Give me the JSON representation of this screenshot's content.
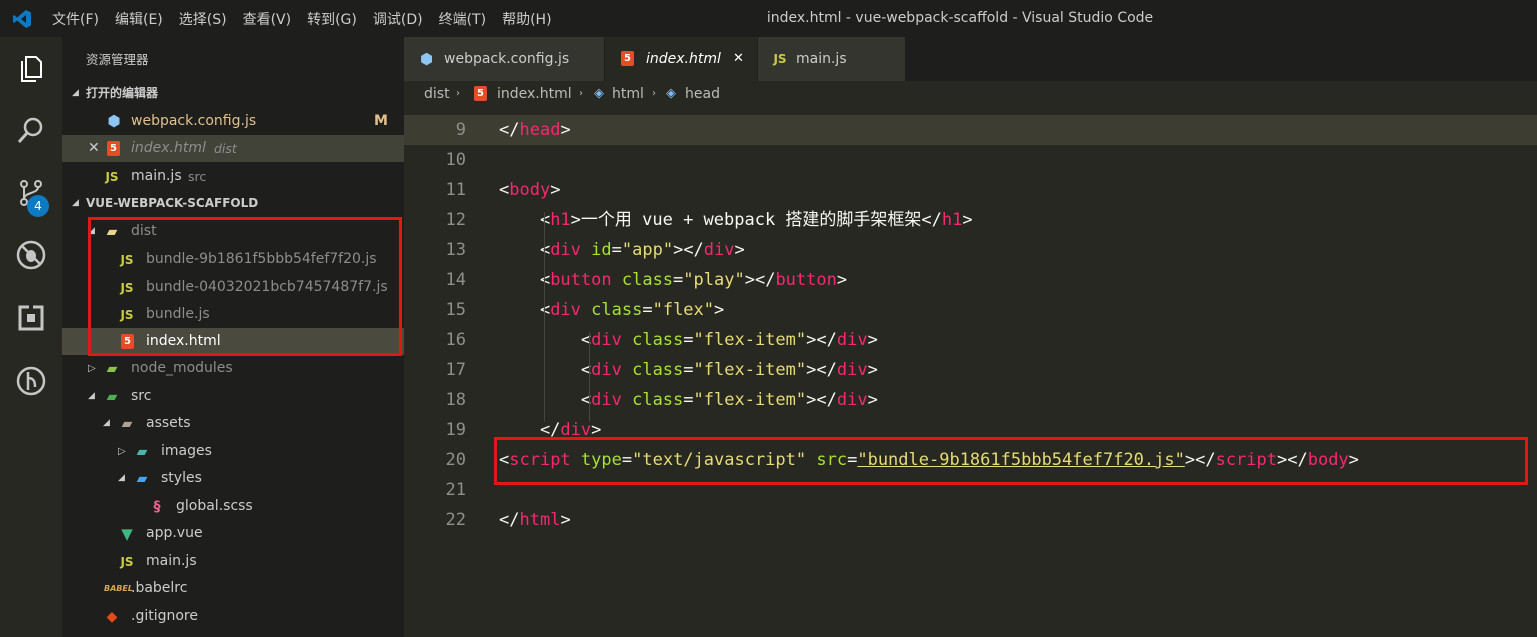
{
  "menu": [
    "文件(F)",
    "编辑(E)",
    "选择(S)",
    "查看(V)",
    "转到(G)",
    "调试(D)",
    "终端(T)",
    "帮助(H)"
  ],
  "window_title": "index.html - vue-webpack-scaffold - Visual Studio Code",
  "activity": {
    "scm_badge": "4"
  },
  "sidebar": {
    "title": "资源管理器",
    "open_editors_header": "打开的编辑器",
    "open_editors": [
      {
        "name": "webpack.config.js",
        "status": "M"
      },
      {
        "name": "index.html",
        "desc": "dist"
      },
      {
        "name": "main.js",
        "desc": "src"
      }
    ],
    "project_header": "VUE-WEBPACK-SCAFFOLD",
    "tree": [
      {
        "name": "dist"
      },
      {
        "name": "bundle-9b1861f5bbb54fef7f20.js"
      },
      {
        "name": "bundle-04032021bcb7457487f7.js"
      },
      {
        "name": "bundle.js"
      },
      {
        "name": "index.html"
      },
      {
        "name": "node_modules"
      },
      {
        "name": "src"
      },
      {
        "name": "assets"
      },
      {
        "name": "images"
      },
      {
        "name": "styles"
      },
      {
        "name": "global.scss"
      },
      {
        "name": "app.vue"
      },
      {
        "name": "main.js"
      },
      {
        "name": ".babelrc"
      },
      {
        "name": ".gitignore"
      }
    ]
  },
  "tabs": [
    {
      "label": "webpack.config.js"
    },
    {
      "label": "index.html",
      "close": "✕"
    },
    {
      "label": "main.js"
    }
  ],
  "breadcrumb": [
    "dist",
    "index.html",
    "html",
    "head"
  ],
  "editor": {
    "line_numbers": [
      "9",
      "10",
      "11",
      "12",
      "13",
      "14",
      "15",
      "16",
      "17",
      "18",
      "19",
      "20",
      "21",
      "22"
    ],
    "lines": [
      [
        [
          "p",
          "</"
        ],
        [
          "t",
          "head"
        ],
        [
          "p",
          ">"
        ]
      ],
      [],
      [
        [
          "p",
          "<"
        ],
        [
          "t",
          "body"
        ],
        [
          "p",
          ">"
        ]
      ],
      [
        [
          "p",
          "    <"
        ],
        [
          "t",
          "h1"
        ],
        [
          "p",
          ">一个用 vue + webpack 搭建的脚手架框架</"
        ],
        [
          "t",
          "h1"
        ],
        [
          "p",
          ">"
        ]
      ],
      [
        [
          "p",
          "    <"
        ],
        [
          "t",
          "div"
        ],
        [
          "p",
          " "
        ],
        [
          "a",
          "id"
        ],
        [
          "p",
          "="
        ],
        [
          "s",
          "\"app\""
        ],
        [
          "p",
          "></"
        ],
        [
          "t",
          "div"
        ],
        [
          "p",
          ">"
        ]
      ],
      [
        [
          "p",
          "    <"
        ],
        [
          "t",
          "button"
        ],
        [
          "p",
          " "
        ],
        [
          "a",
          "class"
        ],
        [
          "p",
          "="
        ],
        [
          "s",
          "\"play\""
        ],
        [
          "p",
          "></"
        ],
        [
          "t",
          "button"
        ],
        [
          "p",
          ">"
        ]
      ],
      [
        [
          "p",
          "    <"
        ],
        [
          "t",
          "div"
        ],
        [
          "p",
          " "
        ],
        [
          "a",
          "class"
        ],
        [
          "p",
          "="
        ],
        [
          "s",
          "\"flex\""
        ],
        [
          "p",
          ">"
        ]
      ],
      [
        [
          "p",
          "        <"
        ],
        [
          "t",
          "div"
        ],
        [
          "p",
          " "
        ],
        [
          "a",
          "class"
        ],
        [
          "p",
          "="
        ],
        [
          "s",
          "\"flex-item\""
        ],
        [
          "p",
          "></"
        ],
        [
          "t",
          "div"
        ],
        [
          "p",
          ">"
        ]
      ],
      [
        [
          "p",
          "        <"
        ],
        [
          "t",
          "div"
        ],
        [
          "p",
          " "
        ],
        [
          "a",
          "class"
        ],
        [
          "p",
          "="
        ],
        [
          "s",
          "\"flex-item\""
        ],
        [
          "p",
          "></"
        ],
        [
          "t",
          "div"
        ],
        [
          "p",
          ">"
        ]
      ],
      [
        [
          "p",
          "        <"
        ],
        [
          "t",
          "div"
        ],
        [
          "p",
          " "
        ],
        [
          "a",
          "class"
        ],
        [
          "p",
          "="
        ],
        [
          "s",
          "\"flex-item\""
        ],
        [
          "p",
          "></"
        ],
        [
          "t",
          "div"
        ],
        [
          "p",
          ">"
        ]
      ],
      [
        [
          "p",
          "    </"
        ],
        [
          "t",
          "div"
        ],
        [
          "p",
          ">"
        ]
      ],
      [
        [
          "p",
          "<"
        ],
        [
          "t",
          "script"
        ],
        [
          "p",
          " "
        ],
        [
          "a",
          "type"
        ],
        [
          "p",
          "="
        ],
        [
          "s",
          "\"text/javascript\""
        ],
        [
          "p",
          " "
        ],
        [
          "a",
          "src"
        ],
        [
          "p",
          "="
        ],
        [
          "s",
          "\"bundle-9b1861f5bbb54fef7f20.js\""
        ],
        [
          "p",
          "></"
        ],
        [
          "t",
          "script"
        ],
        [
          "p",
          "></"
        ],
        [
          "t",
          "body"
        ],
        [
          "p",
          ">"
        ]
      ],
      [],
      [
        [
          "p",
          "</"
        ],
        [
          "t",
          "html"
        ],
        [
          "p",
          ">"
        ]
      ]
    ]
  },
  "colors": {
    "tag": "#f92672",
    "attr": "#a6e22e",
    "string": "#e6db74",
    "highlight": "#e21717"
  }
}
